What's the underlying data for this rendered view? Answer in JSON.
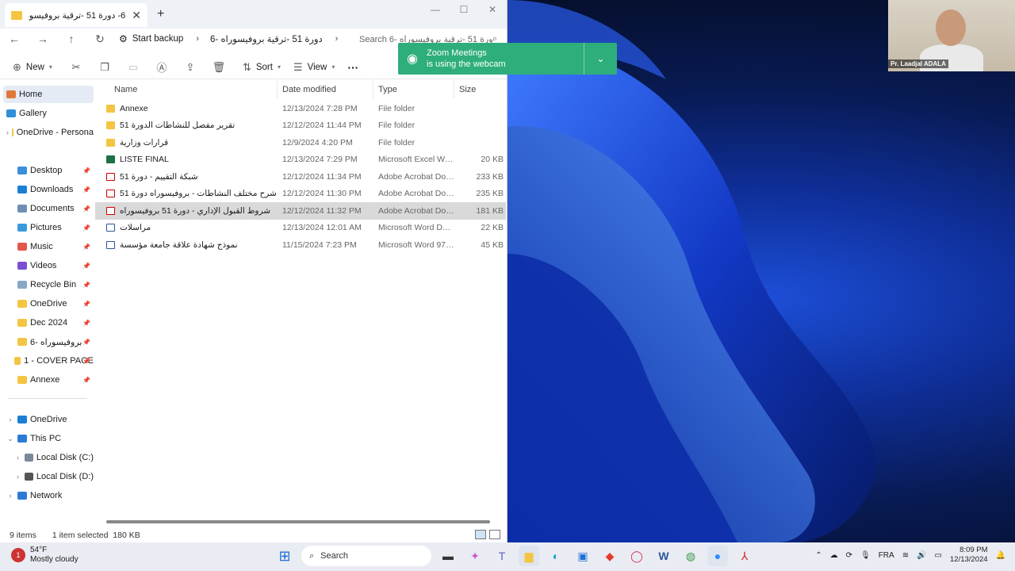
{
  "window": {
    "tab_title": "6-  دورة 51 -ترقية بروفيسوراه",
    "new_tab": "+",
    "controls": [
      "—",
      "☐",
      "✕"
    ]
  },
  "address": {
    "start_backup": "Start backup",
    "path": "6-  دورة 51 -ترقية بروفيسوراه",
    "search_placeholder": "Search 6-  دورة 51 -ترقية بروفيسوراه"
  },
  "commands": {
    "new": "New",
    "sort": "Sort",
    "view": "View",
    "more": "···"
  },
  "nav": {
    "home": "Home",
    "gallery": "Gallery",
    "onedrive_personal": "OneDrive - Persona",
    "quick": [
      {
        "label": "Desktop",
        "color": "#3b8edb"
      },
      {
        "label": "Downloads",
        "color": "#1c7fd6"
      },
      {
        "label": "Documents",
        "color": "#6e8fb3"
      },
      {
        "label": "Pictures",
        "color": "#3a9ad9"
      },
      {
        "label": "Music",
        "color": "#e2574c"
      },
      {
        "label": "Videos",
        "color": "#7b4fd1"
      },
      {
        "label": "Recycle Bin",
        "color": "#8aa7c4"
      },
      {
        "label": "OneDrive",
        "color": "#f4c542"
      },
      {
        "label": "Dec 2024",
        "color": "#f4c542"
      },
      {
        "label": "6-  بروفيسوراه",
        "color": "#f4c542"
      },
      {
        "label": "1 - COVER PAGE",
        "color": "#f4c542"
      },
      {
        "label": "Annexe",
        "color": "#f4c542"
      }
    ],
    "tree": [
      {
        "label": "OneDrive",
        "chev": "›",
        "color": "#1c7fd6"
      },
      {
        "label": "This PC",
        "chev": "⌄",
        "color": "#2b7bd6"
      },
      {
        "label": "Local Disk (C:)",
        "chev": "›",
        "color": "#7a8899"
      },
      {
        "label": "Local Disk (D:)",
        "chev": "›",
        "color": "#555555"
      },
      {
        "label": "Network",
        "chev": "›",
        "color": "#2b7bd6"
      }
    ]
  },
  "columns": {
    "name": "Name",
    "date": "Date modified",
    "type": "Type",
    "size": "Size"
  },
  "files": [
    {
      "name": "Annexe",
      "date": "12/13/2024 7:28 PM",
      "type": "File folder",
      "size": "",
      "kind": "folder"
    },
    {
      "name": "تقرير مفصل للنشاطات الدورة 51",
      "date": "12/12/2024 11:44 PM",
      "type": "File folder",
      "size": "",
      "kind": "folder"
    },
    {
      "name": "قرارات وزارية",
      "date": "12/9/2024 4:20 PM",
      "type": "File folder",
      "size": "",
      "kind": "folder"
    },
    {
      "name": "LISTE FINAL",
      "date": "12/13/2024 7:29 PM",
      "type": "Microsoft Excel Work...",
      "size": "20 KB",
      "kind": "excel"
    },
    {
      "name": "شبكة التقييم - دورة 51",
      "date": "12/12/2024 11:34 PM",
      "type": "Adobe Acrobat Docu...",
      "size": "233 KB",
      "kind": "pdf"
    },
    {
      "name": "شرح مختلف النشاطات - بروفيسوراه دورة 51",
      "date": "12/12/2024 11:30 PM",
      "type": "Adobe Acrobat Docu...",
      "size": "235 KB",
      "kind": "pdf"
    },
    {
      "name": "شروط القبول الإداري - دورة 51 بروفيسوراه",
      "date": "12/12/2024 11:32 PM",
      "type": "Adobe Acrobat Docu...",
      "size": "181 KB",
      "kind": "pdf",
      "selected": true
    },
    {
      "name": "مراسلات",
      "date": "12/13/2024 12:01 AM",
      "type": "Microsoft Word Doc...",
      "size": "22 KB",
      "kind": "word"
    },
    {
      "name": "نموذج شهادة علاقة جامعة مؤسسة",
      "date": "11/15/2024 7:23 PM",
      "type": "Microsoft Word 97 - ...",
      "size": "45 KB",
      "kind": "word"
    }
  ],
  "status": {
    "items": "9 items",
    "selected": "1 item selected  180 KB"
  },
  "toast": {
    "line1": "Zoom Meetings",
    "line2": "is using the webcam"
  },
  "webcam": {
    "name": "Pr. Laadjal ADALA"
  },
  "taskbar": {
    "weather_temp": "54°F",
    "weather_desc": "Mostly cloudy",
    "weather_badge": "1",
    "search": "Search",
    "lang": "FRA",
    "time": "8:09 PM",
    "date": "12/13/2024"
  }
}
